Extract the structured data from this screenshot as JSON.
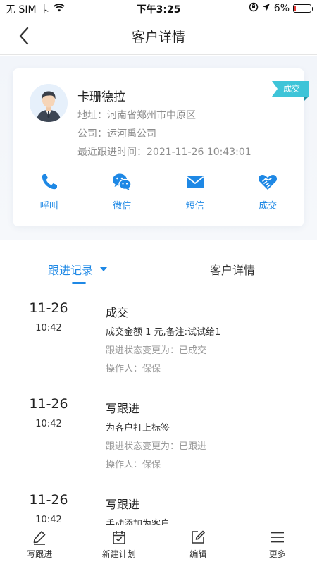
{
  "status_bar": {
    "carrier": "无 SIM 卡",
    "time": "下午3:25",
    "battery_percent": "6%",
    "battery_level": 0.06
  },
  "nav": {
    "title": "客户详情",
    "back_icon": "back-arrow-icon"
  },
  "customer": {
    "name": "卡珊德拉",
    "address": "地址：河南省郑州市中原区",
    "company": "公司：运河禹公司",
    "last_followup": "最近跟进时间：2021-11-26 10:43:01",
    "status_badge": "成交"
  },
  "actions": [
    {
      "label": "呼叫",
      "icon": "phone-icon"
    },
    {
      "label": "微信",
      "icon": "wechat-icon"
    },
    {
      "label": "短信",
      "icon": "mail-icon"
    },
    {
      "label": "成交",
      "icon": "handshake-icon"
    }
  ],
  "tabs": {
    "left": "跟进记录",
    "right": "客户详情"
  },
  "timeline": [
    {
      "date": "11-26",
      "time": "10:42",
      "title": "成交",
      "line1": "成交金额 1 元,备注:试试给1",
      "line2": "跟进状态变更为：已成交",
      "line3": "操作人：保保"
    },
    {
      "date": "11-26",
      "time": "10:42",
      "title": "写跟进",
      "line1": "为客户打上标签",
      "line2": "跟进状态变更为：已跟进",
      "line3": "操作人：保保"
    },
    {
      "date": "11-26",
      "time": "10:42",
      "title": "写跟进",
      "line1": "手动添加为客户",
      "line2": "",
      "line3": ""
    }
  ],
  "bottom_bar": [
    {
      "label": "写跟进",
      "icon": "pen-icon"
    },
    {
      "label": "新建计划",
      "icon": "calendar-check-icon"
    },
    {
      "label": "编辑",
      "icon": "edit-icon"
    },
    {
      "label": "更多",
      "icon": "menu-icon"
    }
  ],
  "colors": {
    "accent": "#1e88e5",
    "badge": "#3ec4d8",
    "battery_low": "#e53935"
  }
}
